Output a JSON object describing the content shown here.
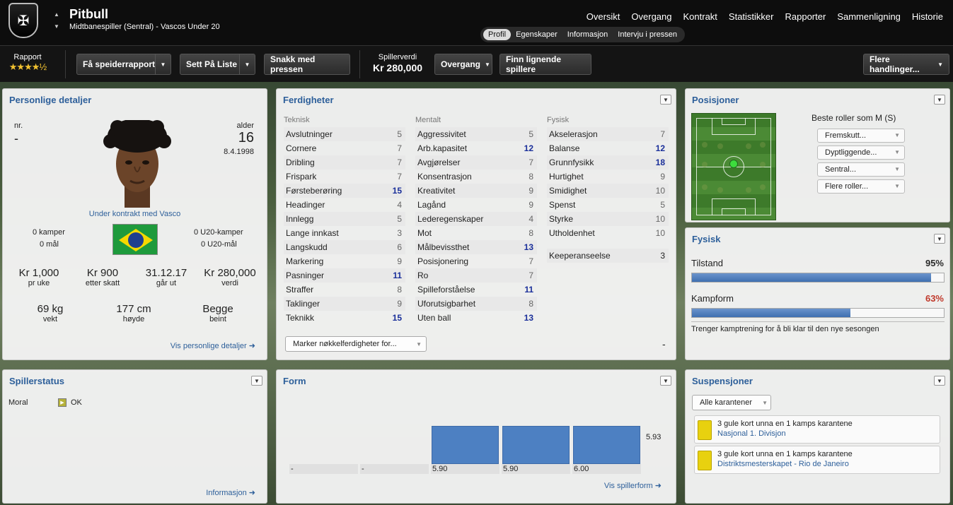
{
  "header": {
    "player_name": "Pitbull",
    "subtitle": "Midtbanespiller (Sentral) - Vascos Under 20",
    "nav": [
      "Oversikt",
      "Overgang",
      "Kontrakt",
      "Statistikker",
      "Rapporter",
      "Sammenligning",
      "Historie"
    ],
    "subnav": [
      "Profil",
      "Egenskaper",
      "Informasjon",
      "Intervju i pressen"
    ],
    "subnav_active": "Profil"
  },
  "toolbar": {
    "rapport_label": "Rapport",
    "rapport_stars": "★★★★½",
    "scout_report": "Få speiderrapport",
    "add_to_list": "Sett På Liste",
    "talk_press": "Snakk med pressen",
    "value_label": "Spillerverdi",
    "value": "Kr 280,000",
    "transfer": "Overgang",
    "find_similar": "Finn lignende spillere",
    "more_actions": "Flere handlinger..."
  },
  "personal": {
    "title": "Personlige detaljer",
    "nr_label": "nr.",
    "nr_value": "-",
    "age_label": "alder",
    "age": "16",
    "dob": "8.4.1998",
    "contract": "Under kontrakt med Vasco",
    "matches": "0 kamper",
    "goals": "0 mål",
    "u20_matches": "0 U20-kamper",
    "u20_goals": "0 U20-mål",
    "wage": "Kr 1,000",
    "wage_label": "pr uke",
    "after_tax": "Kr 900",
    "after_tax_label": "etter skatt",
    "expires": "31.12.17",
    "expires_label": "går ut",
    "value": "Kr 280,000",
    "value_label": "verdi",
    "weight": "69 kg",
    "weight_label": "vekt",
    "height": "177 cm",
    "height_label": "høyde",
    "foot": "Begge",
    "foot_label": "beint",
    "link": "Vis personlige detaljer ➜"
  },
  "skills": {
    "title": "Ferdigheter",
    "tech_header": "Teknisk",
    "mental_header": "Mentalt",
    "physical_header": "Fysisk",
    "technical": [
      {
        "name": "Avslutninger",
        "value": "5",
        "hi": false
      },
      {
        "name": "Cornere",
        "value": "7",
        "hi": false
      },
      {
        "name": "Dribling",
        "value": "7",
        "hi": false
      },
      {
        "name": "Frispark",
        "value": "7",
        "hi": false
      },
      {
        "name": "Førsteberøring",
        "value": "15",
        "hi": true
      },
      {
        "name": "Headinger",
        "value": "4",
        "hi": false
      },
      {
        "name": "Innlegg",
        "value": "5",
        "hi": false
      },
      {
        "name": "Lange innkast",
        "value": "3",
        "hi": false
      },
      {
        "name": "Langskudd",
        "value": "6",
        "hi": false
      },
      {
        "name": "Markering",
        "value": "9",
        "hi": false
      },
      {
        "name": "Pasninger",
        "value": "11",
        "hi": true
      },
      {
        "name": "Straffer",
        "value": "8",
        "hi": false
      },
      {
        "name": "Taklinger",
        "value": "9",
        "hi": false
      },
      {
        "name": "Teknikk",
        "value": "15",
        "hi": true
      }
    ],
    "mental": [
      {
        "name": "Aggressivitet",
        "value": "5",
        "hi": false
      },
      {
        "name": "Arb.kapasitet",
        "value": "12",
        "hi": true
      },
      {
        "name": "Avgjørelser",
        "value": "7",
        "hi": false
      },
      {
        "name": "Konsentrasjon",
        "value": "8",
        "hi": false
      },
      {
        "name": "Kreativitet",
        "value": "9",
        "hi": false
      },
      {
        "name": "Lagånd",
        "value": "9",
        "hi": false
      },
      {
        "name": "Lederegenskaper",
        "value": "4",
        "hi": false
      },
      {
        "name": "Mot",
        "value": "8",
        "hi": false
      },
      {
        "name": "Målbevissthet",
        "value": "13",
        "hi": true
      },
      {
        "name": "Posisjonering",
        "value": "7",
        "hi": false
      },
      {
        "name": "Ro",
        "value": "7",
        "hi": false
      },
      {
        "name": "Spilleforståelse",
        "value": "11",
        "hi": true
      },
      {
        "name": "Uforutsigbarhet",
        "value": "8",
        "hi": false
      },
      {
        "name": "Uten ball",
        "value": "13",
        "hi": true
      }
    ],
    "physical": [
      {
        "name": "Akselerasjon",
        "value": "7",
        "hi": false
      },
      {
        "name": "Balanse",
        "value": "12",
        "hi": true
      },
      {
        "name": "Grunnfysikk",
        "value": "18",
        "hi": true
      },
      {
        "name": "Hurtighet",
        "value": "9",
        "hi": false
      },
      {
        "name": "Smidighet",
        "value": "10",
        "hi": false
      },
      {
        "name": "Spenst",
        "value": "5",
        "hi": false
      },
      {
        "name": "Styrke",
        "value": "10",
        "hi": false
      },
      {
        "name": "Utholdenhet",
        "value": "10",
        "hi": false
      }
    ],
    "keeper_label": "Keeperanseelse",
    "keeper_value": "3",
    "key_select": "Marker nøkkelferdigheter for...",
    "dash": "-"
  },
  "positions": {
    "title": "Posisjoner",
    "best_roles": "Beste roller som M (S)",
    "roles": [
      "Fremskutt...",
      "Dyptliggende...",
      "Sentral...",
      "Flere roller..."
    ]
  },
  "physical_status": {
    "title": "Fysisk",
    "condition_label": "Tilstand",
    "condition": "95%",
    "condition_frac": 0.95,
    "form_label": "Kampform",
    "form": "63%",
    "form_frac": 0.63,
    "note": "Trenger kamptrening for å bli klar til den nye sesongen",
    "good_color": "#2a2a2a",
    "bad_color": "#c0392b"
  },
  "player_status": {
    "title": "Spillerstatus",
    "moral_label": "Moral",
    "moral_value": "OK",
    "link": "Informasjon ➜"
  },
  "form": {
    "title": "Form",
    "avg_label": "5.93",
    "link": "Vis spillerform ➜"
  },
  "chart_data": {
    "type": "bar",
    "categories": [
      "-",
      "-",
      "5.90",
      "5.90",
      "6.00"
    ],
    "values": [
      null,
      null,
      5.9,
      5.9,
      6.0
    ],
    "average": 5.93
  },
  "suspensions": {
    "title": "Suspensjoner",
    "filter": "Alle karantener",
    "items": [
      {
        "text": "3 gule kort unna en 1 kamps karantene",
        "competition": "Nasjonal 1. Divisjon"
      },
      {
        "text": "3 gule kort unna en 1 kamps karantene",
        "competition": "Distriktsmesterskapet - Rio de Janeiro"
      }
    ],
    "card_color": "#e8d10f"
  }
}
